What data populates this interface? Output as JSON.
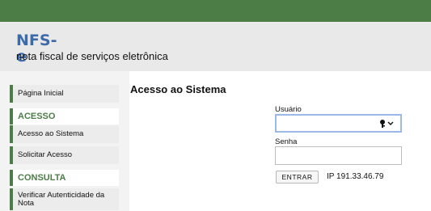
{
  "header": {
    "logo_text": "NFS-e",
    "logo_tagline": "nota fiscal de serviços eletrônica"
  },
  "sidebar": {
    "home": "Página Inicial",
    "sections": [
      {
        "title": "ACESSO",
        "items": [
          "Acesso ao Sistema",
          "Solicitar Acesso"
        ]
      },
      {
        "title": "CONSULTA",
        "items": [
          "Verificar Autenticidade da Nota"
        ]
      }
    ]
  },
  "main": {
    "title": "Acesso ao Sistema",
    "username_label": "Usuário",
    "username_value": "",
    "password_label": "Senha",
    "password_value": "",
    "submit_label": "ENTRAR",
    "ip_text": "IP 191.33.46.79"
  },
  "colors": {
    "brand_green": "#4c7d47",
    "logo_blue": "#3d6aa8",
    "focus_blue": "#9cb8e6"
  },
  "icons": [
    "key-icon",
    "chevron-down-icon"
  ]
}
